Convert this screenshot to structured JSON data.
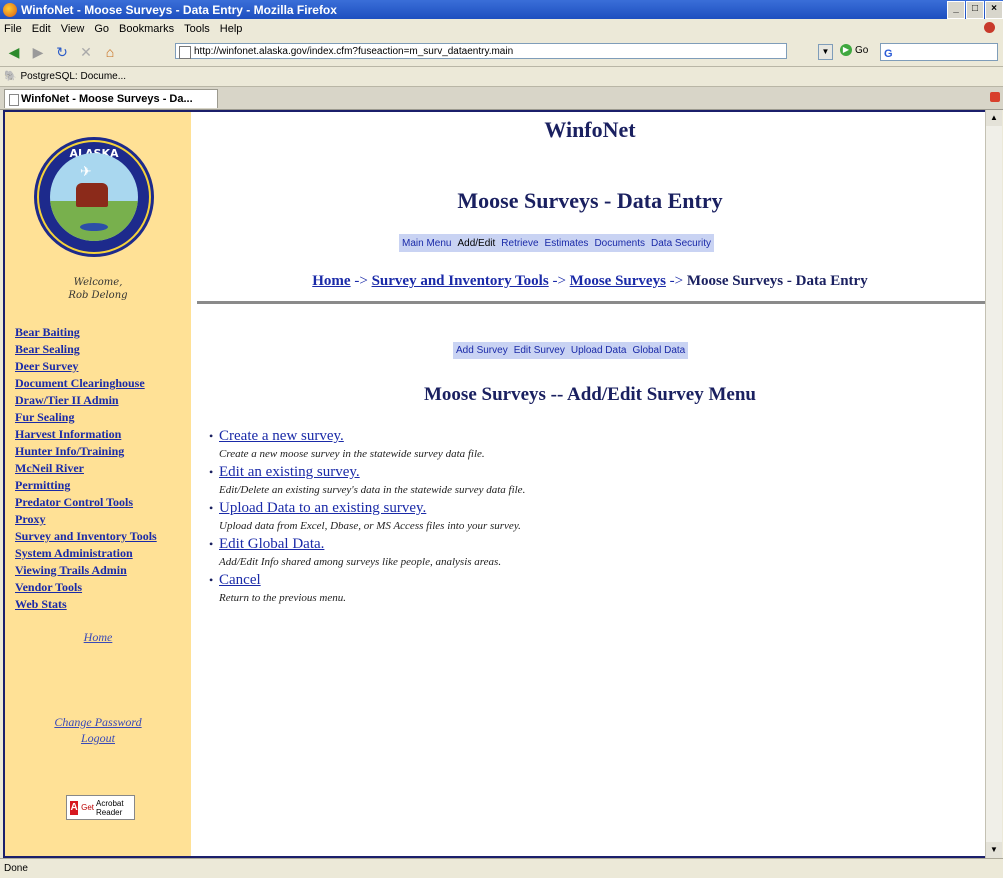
{
  "window": {
    "title": "WinfoNet - Moose Surveys - Data Entry - Mozilla Firefox",
    "minimize": "_",
    "maximize": "□",
    "close": "×"
  },
  "menubar": [
    "File",
    "Edit",
    "View",
    "Go",
    "Bookmarks",
    "Tools",
    "Help"
  ],
  "toolbar": {
    "url": "http://winfonet.alaska.gov/index.cfm?fuseaction=m_surv_dataentry.main",
    "go_label": "Go",
    "search_engine": "G"
  },
  "bookmarks": [
    {
      "label": "PostgreSQL: Docume..."
    }
  ],
  "tabs": [
    {
      "label": "WinfoNet - Moose Surveys - Da..."
    }
  ],
  "sidebar": {
    "welcome_line1": "Welcome,",
    "welcome_line2": "Rob Delong",
    "nav": [
      "Bear Baiting",
      "Bear Sealing",
      "Deer Survey",
      "Document Clearinghouse",
      "Draw/Tier II Admin",
      "Fur Sealing",
      "Harvest Information",
      "Hunter Info/Training",
      "McNeil River",
      "Permitting",
      "Predator Control Tools",
      "Proxy",
      "Survey and Inventory Tools",
      "System Administration",
      "Viewing Trails Admin",
      "Vendor Tools",
      "Web Stats"
    ],
    "home": "Home",
    "change_password": "Change Password",
    "logout": "Logout",
    "acrobat_get": "Get",
    "acrobat_label": "Acrobat Reader"
  },
  "main": {
    "site_title": "WinfoNet",
    "page_title": "Moose Surveys - Data Entry",
    "top_menu": [
      {
        "label": "Main Menu",
        "current": false
      },
      {
        "label": "Add/Edit",
        "current": true
      },
      {
        "label": "Retrieve",
        "current": false
      },
      {
        "label": "Estimates",
        "current": false
      },
      {
        "label": "Documents",
        "current": false
      },
      {
        "label": "Data Security",
        "current": false
      }
    ],
    "breadcrumb": {
      "home": "Home",
      "sep": "->",
      "survey_tools": "Survey and Inventory Tools",
      "moose_surveys": "Moose Surveys",
      "current": "Moose Surveys - Data Entry"
    },
    "sub_menu": [
      "Add Survey",
      "Edit Survey",
      "Upload Data",
      "Global Data"
    ],
    "menu_title": "Moose Surveys -- Add/Edit Survey Menu",
    "options": [
      {
        "label": "Create a new survey.",
        "desc": "Create a new moose survey in the statewide survey data file."
      },
      {
        "label": "Edit an existing survey.",
        "desc": "Edit/Delete an existing survey's data in the statewide survey data file."
      },
      {
        "label": "Upload Data to an existing survey.",
        "desc": "Upload data from Excel, Dbase, or MS Access files into your survey."
      },
      {
        "label": "Edit Global Data.",
        "desc": "Add/Edit Info shared among surveys like people, analysis areas."
      },
      {
        "label": "Cancel",
        "desc": "Return to the previous menu."
      }
    ]
  },
  "status": "Done"
}
